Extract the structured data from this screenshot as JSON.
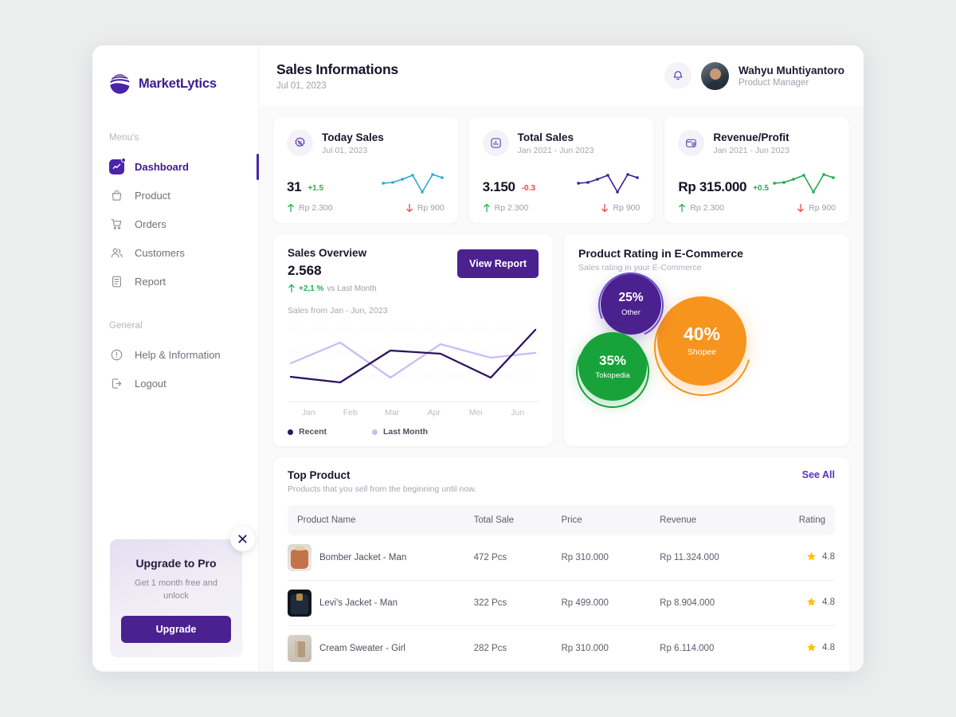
{
  "brand": {
    "name": "MarketLytics",
    "logo_icon": "wave-circle-logo"
  },
  "sidebar": {
    "menu_label": "Menu's",
    "general_label": "General",
    "items": [
      {
        "label": "Dashboard",
        "icon": "dashboard-icon",
        "active": true
      },
      {
        "label": "Product",
        "icon": "bag-icon",
        "active": false
      },
      {
        "label": "Orders",
        "icon": "cart-icon",
        "active": false
      },
      {
        "label": "Customers",
        "icon": "users-icon",
        "active": false
      },
      {
        "label": "Report",
        "icon": "document-icon",
        "active": false
      }
    ],
    "general_items": [
      {
        "label": "Help & Information",
        "icon": "info-circle-icon"
      },
      {
        "label": "Logout",
        "icon": "logout-icon"
      }
    ],
    "upgrade": {
      "title": "Upgrade to Pro",
      "subtitle": "Get 1 month free and unlock",
      "button": "Upgrade",
      "close_icon": "close-icon"
    }
  },
  "header": {
    "title": "Sales Informations",
    "date": "Jul 01, 2023",
    "bell_icon": "bell-icon",
    "user": {
      "name": "Wahyu Muhtiyantoro",
      "role": "Product Manager",
      "avatar": "user-avatar"
    }
  },
  "stats": [
    {
      "title": "Today Sales",
      "subtitle": "Jul 01, 2023",
      "icon": "discount-badge-icon",
      "value": "31",
      "delta": "+1.5",
      "delta_dir": "up",
      "up_value": "Rp 2.300",
      "down_value": "Rp 900",
      "spark_color": "#2aa8d8"
    },
    {
      "title": "Total Sales",
      "subtitle": "Jan 2021 - Jun 2023",
      "icon": "bar-chart-icon",
      "value": "3.150",
      "delta": "-0.3",
      "delta_dir": "down",
      "up_value": "Rp 2.300",
      "down_value": "Rp 900",
      "spark_color": "#3a1c92"
    },
    {
      "title": "Revenue/Profit",
      "subtitle": "Jan 2021 - Jun 2023",
      "icon": "wallet-icon",
      "value": "Rp 315.000",
      "delta": "+0.5",
      "delta_dir": "up",
      "up_value": "Rp 2.300",
      "down_value": "Rp 900",
      "spark_color": "#1faa4b"
    }
  ],
  "overview": {
    "title": "Sales Overview",
    "value": "2.568",
    "delta": "+2,1 %",
    "delta_suffix": "vs Last Month",
    "range": "Sales from Jan - Jun, 2023",
    "button": "View Report",
    "legend": [
      {
        "label": "Recent",
        "color": "#2d1362"
      },
      {
        "label": "Last Month",
        "color": "#c9bdf2"
      }
    ]
  },
  "rating": {
    "title": "Product Rating in E-Commerce",
    "subtitle": "Sales rating in your E-Commerce"
  },
  "top_product": {
    "title": "Top Product",
    "subtitle": "Products that you sell from the beginning until now.",
    "see_all": "See All",
    "columns": [
      "Product Name",
      "Total Sale",
      "Price",
      "Revenue",
      "Rating"
    ],
    "rows": [
      {
        "name": "Bomber Jacket  - Man",
        "total_sale": "472 Pcs",
        "price": "Rp 310.000",
        "revenue": "Rp 11.324.000",
        "rating": "4.8",
        "thumb": "#c4724a"
      },
      {
        "name": "Levi's Jacket - Man",
        "total_sale": "322 Pcs",
        "price": "Rp 499.000",
        "revenue": "Rp 8.904.000",
        "rating": "4.8",
        "thumb": "#1f2733"
      },
      {
        "name": "Cream Sweater - Girl",
        "total_sale": "282 Pcs",
        "price": "Rp 310.000",
        "revenue": "Rp 6.114.000",
        "rating": "4.8",
        "thumb": "#c9bdb0"
      }
    ]
  },
  "chart_data": [
    {
      "type": "line",
      "title": "Sales Overview",
      "subtitle": "Sales from Jan - Jun, 2023",
      "categories": [
        "Jan",
        "Feb",
        "Mar",
        "Apr",
        "Mei",
        "Jun"
      ],
      "series": [
        {
          "name": "Recent",
          "color": "#2d1362",
          "values": [
            30,
            22,
            58,
            54,
            29,
            90
          ]
        },
        {
          "name": "Last Month",
          "color": "#c9bdf2",
          "values": [
            48,
            78,
            28,
            76,
            56,
            62
          ]
        }
      ],
      "ylim": [
        0,
        100
      ],
      "grid": true,
      "legend_position": "bottom-left",
      "xlabel": "",
      "ylabel": ""
    },
    {
      "type": "pie",
      "title": "Product Rating in E-Commerce",
      "subtitle": "Sales rating in your E-Commerce",
      "labels": [
        "Shopee",
        "Tokopedia",
        "Other"
      ],
      "values": [
        40,
        35,
        25
      ],
      "value_labels": [
        "40%",
        "35%",
        "25%"
      ],
      "colors": [
        "#f7941e",
        "#18a23a",
        "#4a218f"
      ],
      "legend_position": "in-bubble"
    },
    {
      "type": "line",
      "title": "Today Sales sparkline",
      "values": [
        38,
        42,
        55,
        70,
        8,
        78,
        64
      ],
      "color": "#2aa8d8"
    },
    {
      "type": "line",
      "title": "Total Sales sparkline",
      "values": [
        38,
        42,
        55,
        70,
        8,
        78,
        64
      ],
      "color": "#3a1c92"
    },
    {
      "type": "line",
      "title": "Revenue/Profit sparkline",
      "values": [
        38,
        42,
        55,
        70,
        8,
        78,
        64
      ],
      "color": "#1faa4b"
    }
  ],
  "colors": {
    "brand_purple": "#4a218f",
    "accent_green": "#22b14c",
    "accent_red": "#ef4444",
    "shopee_orange": "#f7941e",
    "tokopedia_green": "#18a23a",
    "other_purple": "#4a218f",
    "star_gold": "#ffc107"
  }
}
